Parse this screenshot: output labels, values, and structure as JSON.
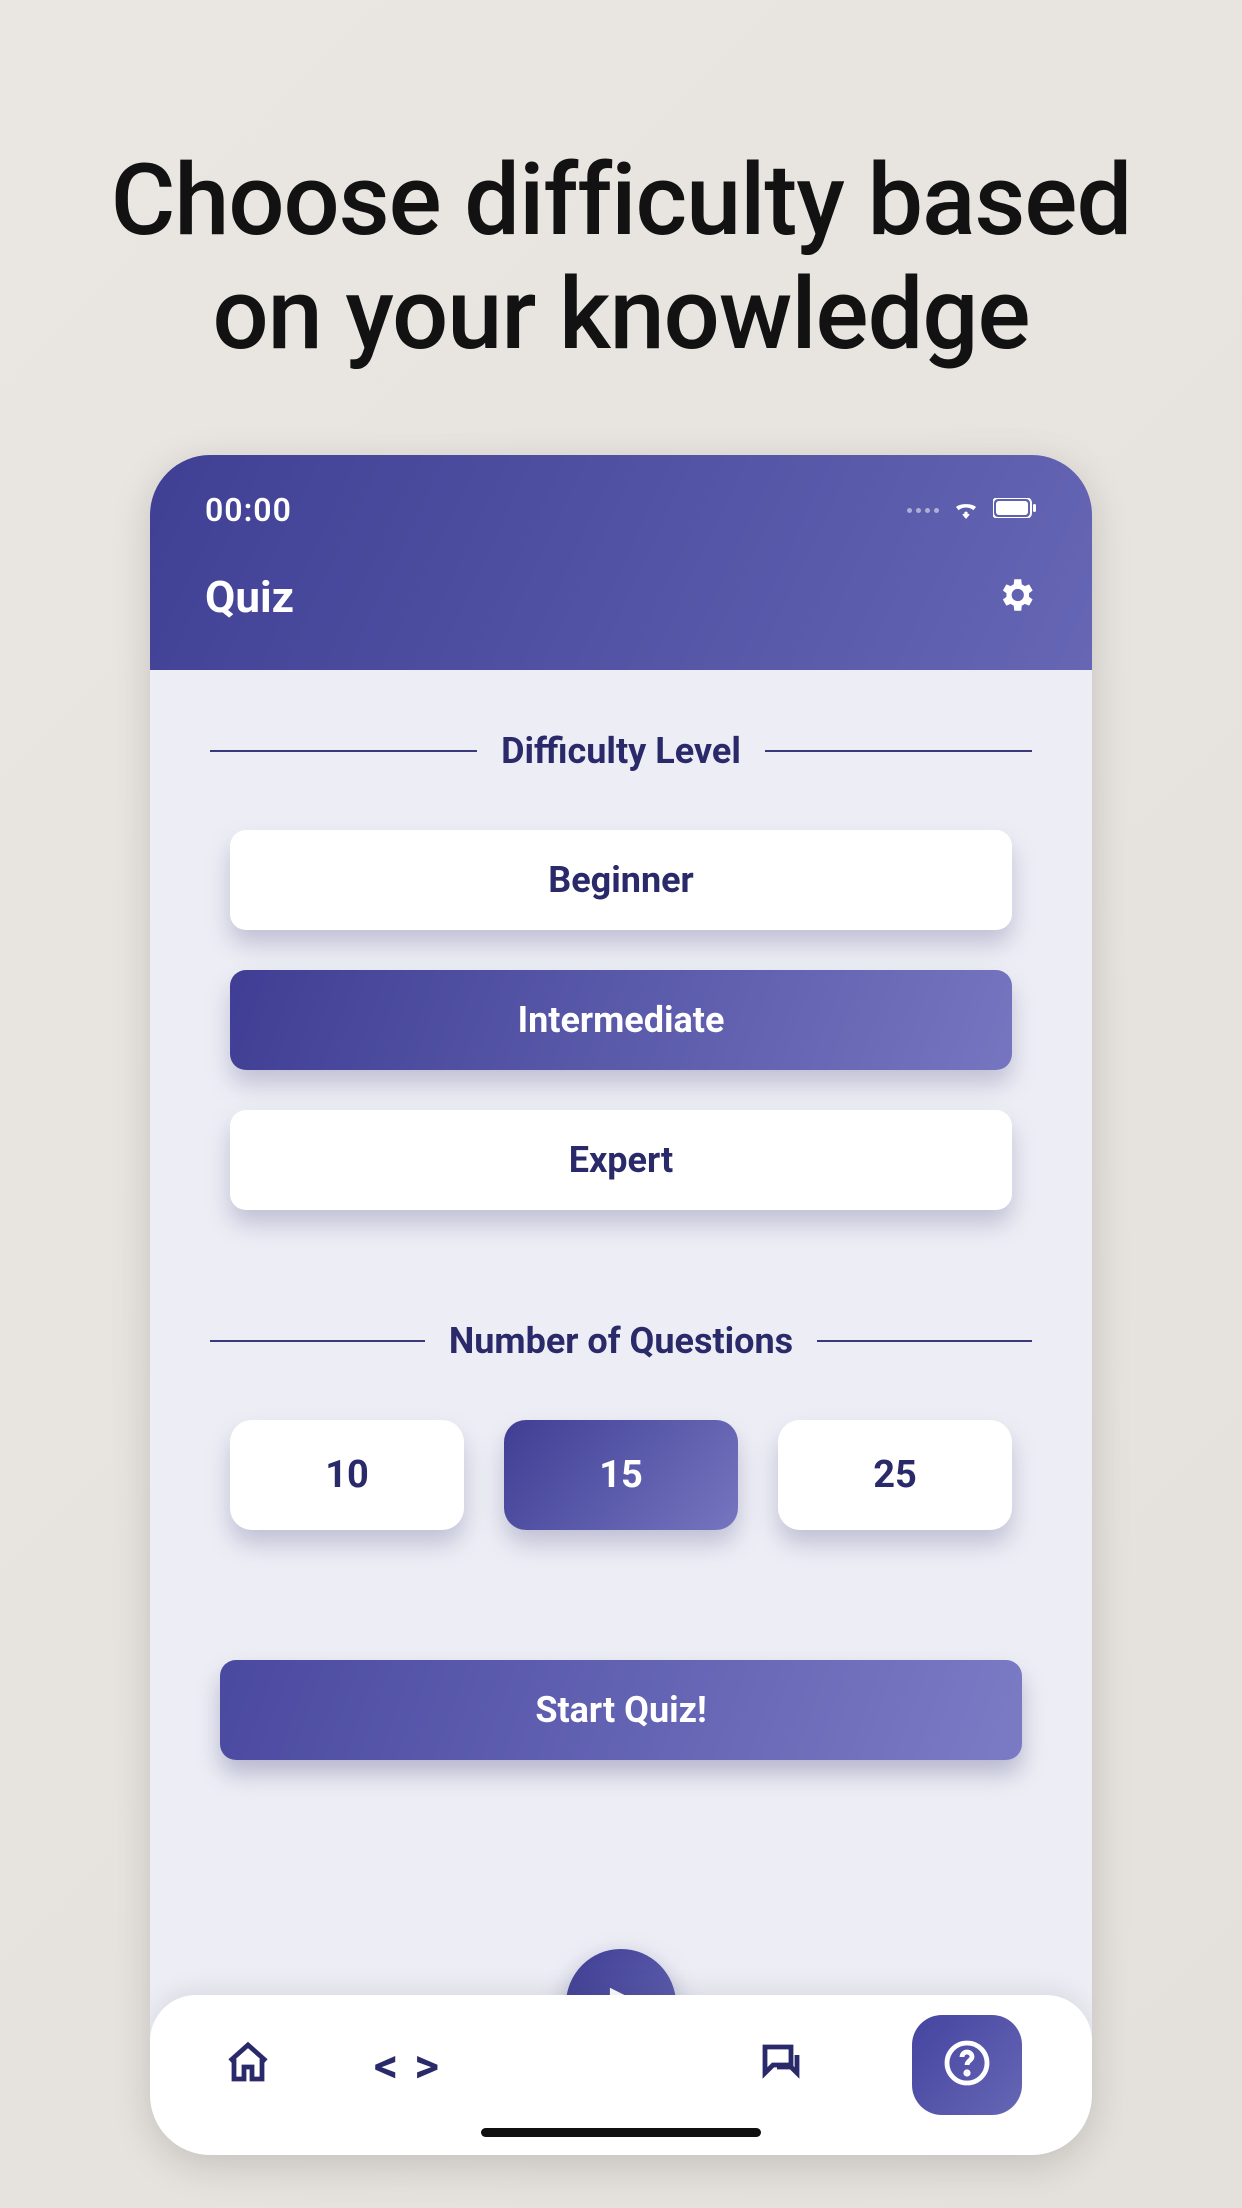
{
  "headline": "Choose difficulty based on your knowledge",
  "status": {
    "time": "00:00"
  },
  "header": {
    "title": "Quiz"
  },
  "sections": {
    "difficulty": {
      "title": "Difficulty Level",
      "options": [
        {
          "label": "Beginner",
          "selected": false
        },
        {
          "label": "Intermediate",
          "selected": true
        },
        {
          "label": "Expert",
          "selected": false
        }
      ]
    },
    "questions": {
      "title": "Number of Questions",
      "options": [
        {
          "label": "10",
          "selected": false
        },
        {
          "label": "15",
          "selected": true
        },
        {
          "label": "25",
          "selected": false
        }
      ]
    }
  },
  "actions": {
    "start": "Start Quiz!"
  }
}
